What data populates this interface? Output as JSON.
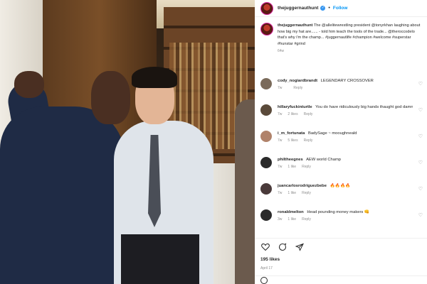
{
  "post": {
    "username": "thejuggernauthunt",
    "verified_mark": "✓",
    "separator": "•",
    "follow_label": "Follow"
  },
  "caption": {
    "username": "thejuggernauthunt",
    "text": "The @allelitewrestling president @tonyrkhan laughing about how big my hat are...... - told him teach the tools of the trade... @theroccodelo that's why i'm the champ... #juggernautlife #champion #welcome #superstar #hunstar #grind",
    "time": "64w"
  },
  "comments": [
    {
      "user": "cody_nogiardbrandt",
      "text": "LEGENDARY CROSSOVER",
      "time": "7w",
      "likes": "",
      "reply": "Reply",
      "avatar_color": "#7a6a5a"
    },
    {
      "user": "hillaryfuckinturtle",
      "text": "You do have ridiculously big hands thaught god damn 😂",
      "time": "7w",
      "likes": "2 likes",
      "reply": "Reply",
      "avatar_color": "#5a4a3a"
    },
    {
      "user": "i_m_fortunata",
      "text": "BadySage ~ mooughneald",
      "time": "7w",
      "likes": "5 likes",
      "reply": "Reply",
      "avatar_color": "#b0826a"
    },
    {
      "user": "philtheegnes",
      "text": "AEW world Champ",
      "time": "7w",
      "likes": "1 like",
      "reply": "Reply",
      "avatar_color": "#2a2a2a"
    },
    {
      "user": "juancarlosrodriguezbebe",
      "text": "🔥🔥🔥🔥",
      "time": "7w",
      "likes": "1 like",
      "reply": "Reply",
      "avatar_color": "#4a3a3a"
    },
    {
      "user": "ronaldmelton",
      "text": "Head pounding money makers 👊",
      "time": "3w",
      "likes": "1 like",
      "reply": "Reply",
      "avatar_color": "#2a2a2a"
    }
  ],
  "actions": {
    "likes": "195 likes",
    "date": "April 17"
  },
  "colors": {
    "link": "#0095f6",
    "meta": "#8e8e8e",
    "text": "#262626"
  }
}
